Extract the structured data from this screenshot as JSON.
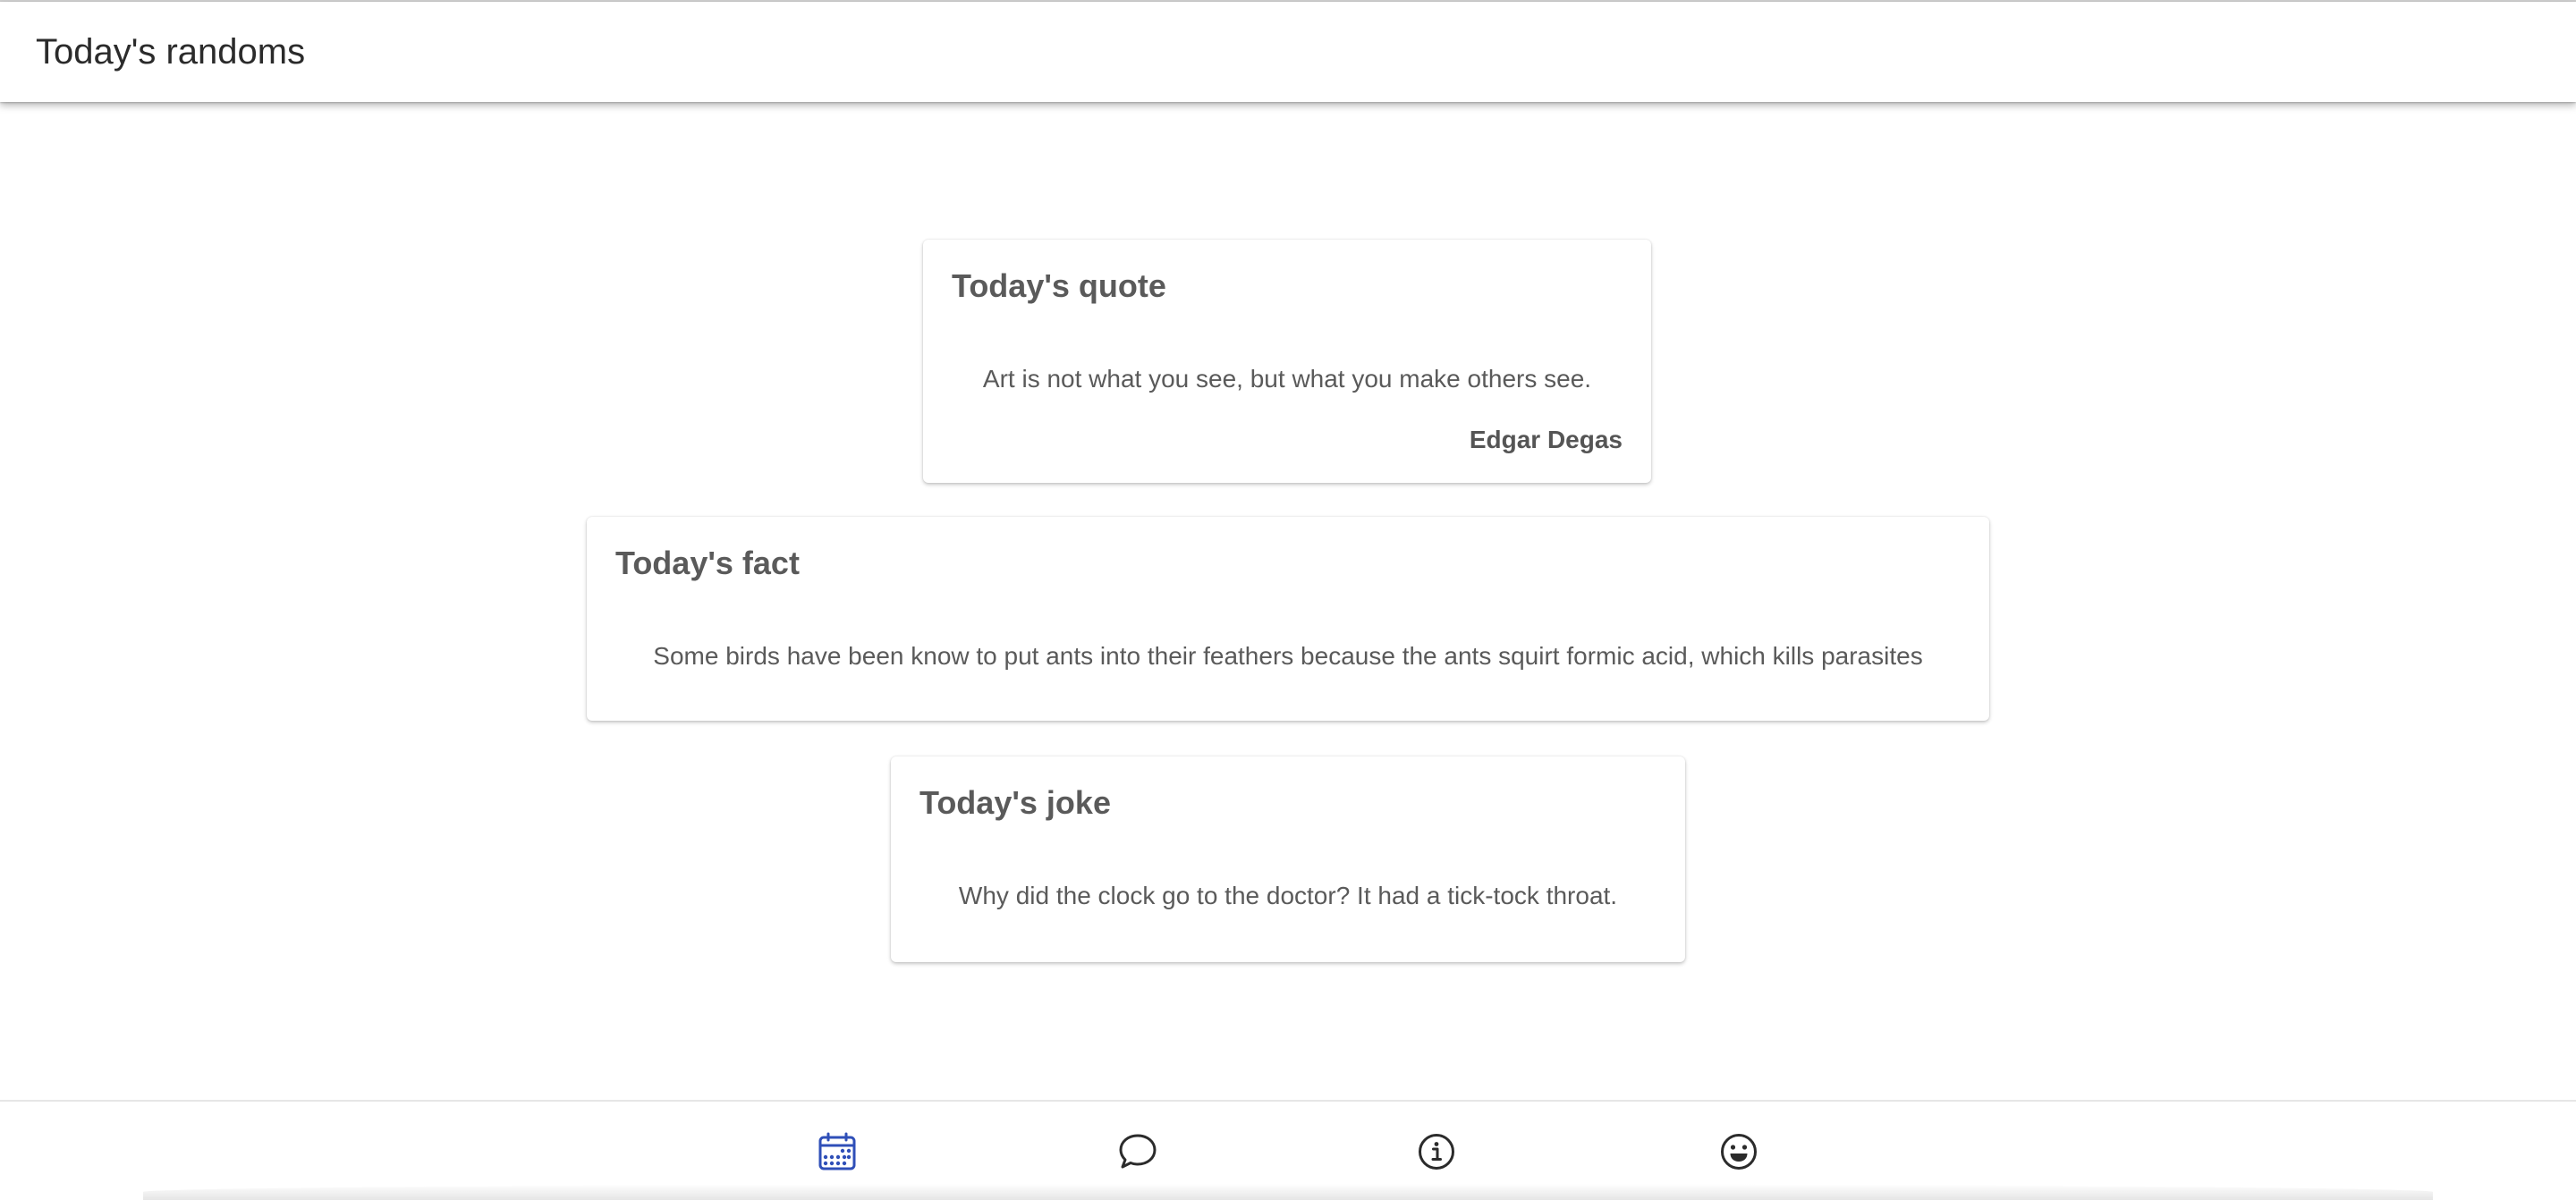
{
  "app_bar": {
    "title": "Today's randoms"
  },
  "cards": {
    "quote": {
      "title": "Today's quote",
      "text": "Art is not what you see, but what you make others see.",
      "author": "Edgar Degas"
    },
    "fact": {
      "title": "Today's fact",
      "text": "Some birds have been know to put ants into their feathers because the ants squirt formic acid, which kills parasites"
    },
    "joke": {
      "title": "Today's joke",
      "text": "Why did the clock go to the doctor? It had a tick-tock throat."
    }
  },
  "bottom_nav": {
    "items": [
      {
        "icon": "calendar-icon",
        "active": true
      },
      {
        "icon": "chat-bubble-icon",
        "active": false
      },
      {
        "icon": "info-icon",
        "active": false
      },
      {
        "icon": "smiley-icon",
        "active": false
      }
    ],
    "active_color": "#2f4fb8",
    "inactive_color": "#2b2b2b"
  }
}
